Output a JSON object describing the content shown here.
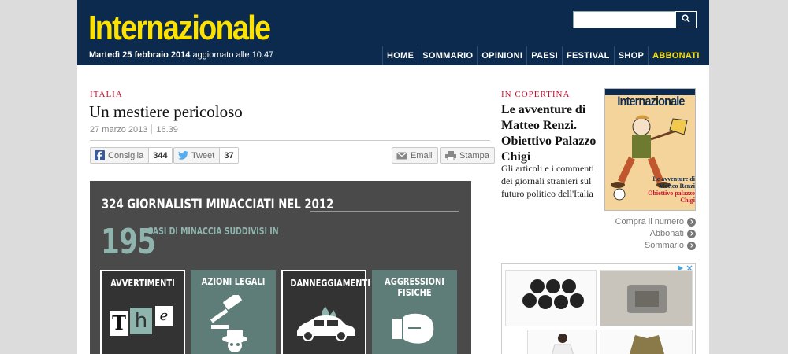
{
  "header": {
    "logo": "Internazionale",
    "date_bold": "Martedì 25 febbraio 2014",
    "date_rest": " aggiornato alle 10.47",
    "search_placeholder": "",
    "nav": [
      "HOME",
      "SOMMARIO",
      "OPINIONI",
      "PAESI",
      "FESTIVAL",
      "SHOP",
      "ABBONATI"
    ]
  },
  "article": {
    "kicker": "ITALIA",
    "title": "Un mestiere pericoloso",
    "date": "27 marzo 2013",
    "time": "16.39",
    "share": {
      "facebook_label": "Consiglia",
      "facebook_count": "344",
      "twitter_label": "Tweet",
      "twitter_count": "37",
      "email_label": "Email",
      "print_label": "Stampa"
    },
    "infographic": {
      "title": "324 GIORNALISTI MINACCIATI NEL 2012",
      "number": "195",
      "subtitle": "CASI DI MINACCIA SUDDIVISI IN",
      "tiles": [
        "AVVERTIMENTI",
        "AZIONI LEGALI",
        "DANNEGGIAMENTI",
        "AGGRESSIONI FISICHE"
      ],
      "ransom_letters": [
        "T",
        "h",
        "e"
      ]
    }
  },
  "sidebar": {
    "kicker": "IN COPERTINA",
    "title": "Le avventure di Matteo Renzi. Obiettivo Palazzo Chigi",
    "description": "Gli articoli e i commenti dei giornali stranieri sul futuro politico dell'Italia",
    "cover": {
      "logo": "Internazionale",
      "headline1": "Le avventure di Matteo Renzi",
      "headline2": "Obiettivo palazzo Chigi"
    },
    "links": [
      "Compra il numero",
      "Abbonati",
      "Sommario"
    ]
  },
  "colors": {
    "header_bg": "#0c2a4e",
    "logo": "#fde100",
    "kicker": "#c8102e",
    "infographic_bg": "#4a4a4a",
    "infographic_accent": "#8fb3ad"
  }
}
